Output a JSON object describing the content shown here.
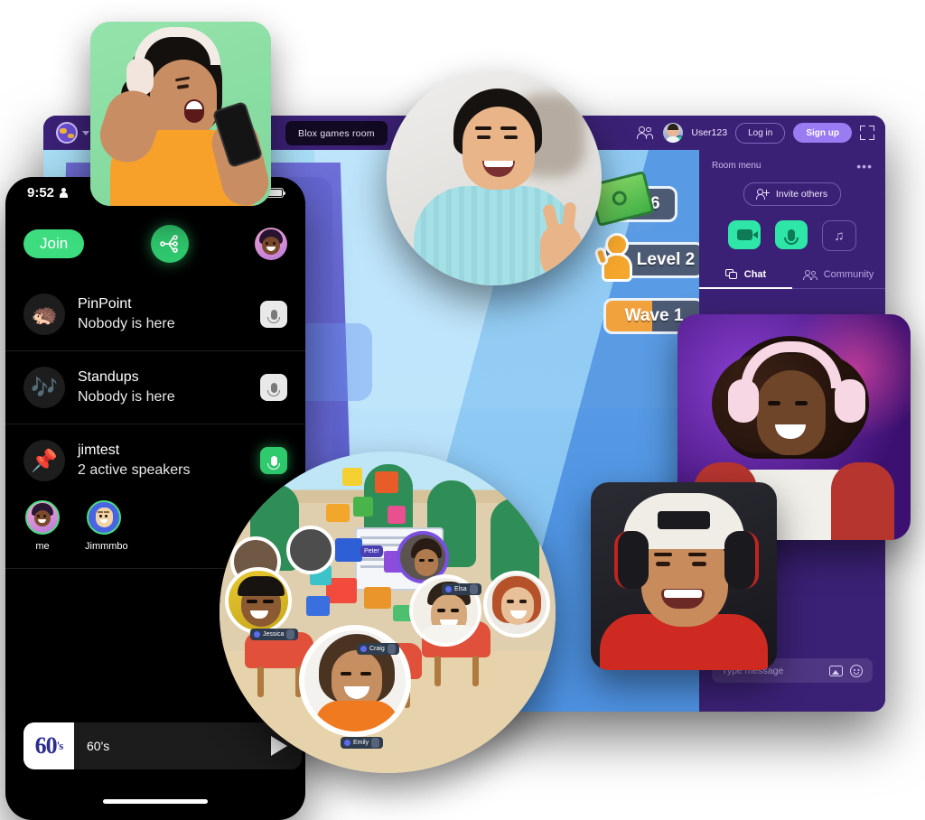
{
  "desktop_app": {
    "topbar": {
      "workspace_icon": "globe-icon",
      "workspace_chevron": "chevron-down-icon",
      "room_tab_label": "Blox games room",
      "people_icon": "people-icon",
      "username": "User123",
      "login_label": "Log in",
      "signup_label": "Sign up",
      "fullscreen_icon": "expand-icon"
    },
    "game": {
      "money_value": "46",
      "level_label": "Level 2",
      "wave_label": "Wave 1"
    },
    "sidebar": {
      "title": "Room menu",
      "more_label": "•••",
      "invite_label": "Invite others",
      "controls": [
        {
          "name": "camera",
          "icon": "camera-icon",
          "state": "on"
        },
        {
          "name": "microphone",
          "icon": "microphone-icon",
          "state": "on"
        },
        {
          "name": "music",
          "icon": "music-note-icon",
          "state": "off"
        }
      ],
      "tabs": [
        {
          "label": "Chat",
          "icon": "chat-icon",
          "active": true
        },
        {
          "label": "Community",
          "icon": "community-icon",
          "active": false
        }
      ],
      "message_placeholder": "Type message",
      "image_icon": "image-icon",
      "emoji_icon": "emoji-icon"
    }
  },
  "phone_app": {
    "status_bar": {
      "time": "9:52",
      "person_icon": "person-icon",
      "wifi_icon": "wifi-icon",
      "battery_icon": "battery-icon"
    },
    "header": {
      "join_label": "Join",
      "hub_icon": "share-network-icon",
      "avatar_name": "me"
    },
    "rooms": [
      {
        "emoji": "🦔",
        "name": "PinPoint",
        "status": "Nobody is here",
        "mic_state": "muted"
      },
      {
        "emoji": "🎶",
        "name": "Standups",
        "status": "Nobody is here",
        "mic_state": "muted"
      },
      {
        "emoji": "📌",
        "name": "jimtest",
        "status": "2 active speakers",
        "mic_state": "live"
      }
    ],
    "speakers": [
      {
        "name": "me"
      },
      {
        "name": "Jimmmbo"
      }
    ],
    "player": {
      "cover_main": "60",
      "cover_sup": "'s",
      "title": "60's",
      "play_icon": "play-icon"
    }
  },
  "collage": {
    "participants": [
      {
        "name": "Jessica"
      },
      {
        "name": "Craig"
      },
      {
        "name": "Emily"
      },
      {
        "name": "Elsa"
      },
      {
        "name": "Peter"
      }
    ]
  },
  "colors": {
    "purple_window": "#3b2175",
    "accent_purple": "#9a7cf2",
    "mint": "#2ee6a8",
    "green": "#3ddc7f",
    "hud_slate": "#4d5a73",
    "hud_orange": "#f2a23c"
  }
}
